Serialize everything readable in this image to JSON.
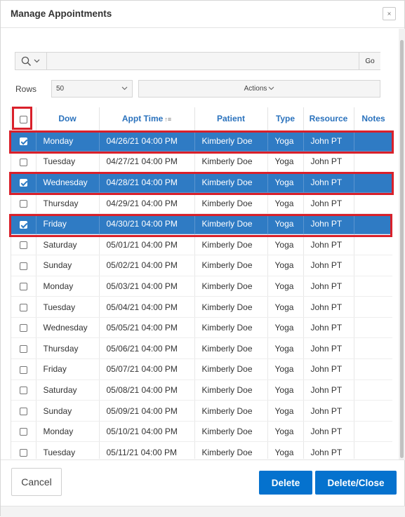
{
  "dialog": {
    "title": "Manage Appointments"
  },
  "toolbar": {
    "search_value": "",
    "go_label": "Go",
    "rows_label": "Rows",
    "rows_value": "50",
    "actions_label": "Actions"
  },
  "grid": {
    "columns": [
      "Dow",
      "Appt Time",
      "Patient",
      "Type",
      "Resource",
      "Notes"
    ],
    "rows": [
      {
        "dow": "Monday",
        "time": "04/26/21 04:00 PM",
        "patient": "Kimberly Doe",
        "type": "Yoga",
        "resource": "John PT",
        "notes": "",
        "selected": true
      },
      {
        "dow": "Tuesday",
        "time": "04/27/21 04:00 PM",
        "patient": "Kimberly Doe",
        "type": "Yoga",
        "resource": "John PT",
        "notes": "",
        "selected": false
      },
      {
        "dow": "Wednesday",
        "time": "04/28/21 04:00 PM",
        "patient": "Kimberly Doe",
        "type": "Yoga",
        "resource": "John PT",
        "notes": "",
        "selected": true
      },
      {
        "dow": "Thursday",
        "time": "04/29/21 04:00 PM",
        "patient": "Kimberly Doe",
        "type": "Yoga",
        "resource": "John PT",
        "notes": "",
        "selected": false
      },
      {
        "dow": "Friday",
        "time": "04/30/21 04:00 PM",
        "patient": "Kimberly Doe",
        "type": "Yoga",
        "resource": "John PT",
        "notes": "",
        "selected": true
      },
      {
        "dow": "Saturday",
        "time": "05/01/21 04:00 PM",
        "patient": "Kimberly Doe",
        "type": "Yoga",
        "resource": "John PT",
        "notes": "",
        "selected": false
      },
      {
        "dow": "Sunday",
        "time": "05/02/21 04:00 PM",
        "patient": "Kimberly Doe",
        "type": "Yoga",
        "resource": "John PT",
        "notes": "",
        "selected": false
      },
      {
        "dow": "Monday",
        "time": "05/03/21 04:00 PM",
        "patient": "Kimberly Doe",
        "type": "Yoga",
        "resource": "John PT",
        "notes": "",
        "selected": false
      },
      {
        "dow": "Tuesday",
        "time": "05/04/21 04:00 PM",
        "patient": "Kimberly Doe",
        "type": "Yoga",
        "resource": "John PT",
        "notes": "",
        "selected": false
      },
      {
        "dow": "Wednesday",
        "time": "05/05/21 04:00 PM",
        "patient": "Kimberly Doe",
        "type": "Yoga",
        "resource": "John PT",
        "notes": "",
        "selected": false
      },
      {
        "dow": "Thursday",
        "time": "05/06/21 04:00 PM",
        "patient": "Kimberly Doe",
        "type": "Yoga",
        "resource": "John PT",
        "notes": "",
        "selected": false
      },
      {
        "dow": "Friday",
        "time": "05/07/21 04:00 PM",
        "patient": "Kimberly Doe",
        "type": "Yoga",
        "resource": "John PT",
        "notes": "",
        "selected": false
      },
      {
        "dow": "Saturday",
        "time": "05/08/21 04:00 PM",
        "patient": "Kimberly Doe",
        "type": "Yoga",
        "resource": "John PT",
        "notes": "",
        "selected": false
      },
      {
        "dow": "Sunday",
        "time": "05/09/21 04:00 PM",
        "patient": "Kimberly Doe",
        "type": "Yoga",
        "resource": "John PT",
        "notes": "",
        "selected": false
      },
      {
        "dow": "Monday",
        "time": "05/10/21 04:00 PM",
        "patient": "Kimberly Doe",
        "type": "Yoga",
        "resource": "John PT",
        "notes": "",
        "selected": false
      },
      {
        "dow": "Tuesday",
        "time": "05/11/21 04:00 PM",
        "patient": "Kimberly Doe",
        "type": "Yoga",
        "resource": "John PT",
        "notes": "",
        "selected": false
      }
    ]
  },
  "footer": {
    "cancel_label": "Cancel",
    "delete_label": "Delete",
    "delete_close_label": "Delete/Close"
  },
  "colors": {
    "selected_row": "#2f7bc4",
    "header_text": "#2a72bd",
    "primary_button": "#0572ce",
    "highlight": "#d9202a"
  }
}
